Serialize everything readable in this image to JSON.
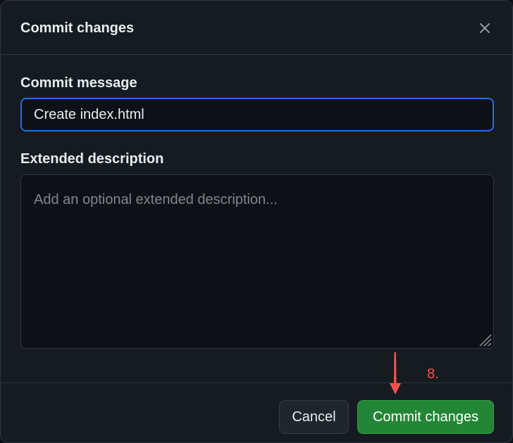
{
  "dialog": {
    "title": "Commit changes",
    "close_label": "Close"
  },
  "form": {
    "message_label": "Commit message",
    "message_value": "Create index.html",
    "description_label": "Extended description",
    "description_placeholder": "Add an optional extended description..."
  },
  "footer": {
    "cancel_label": "Cancel",
    "commit_label": "Commit changes"
  },
  "annotation": {
    "step": "8.",
    "color": "#f85149"
  },
  "icons": {
    "close": "close-icon",
    "resize": "resize-grip-icon",
    "arrow": "down-arrow-icon"
  },
  "colors": {
    "background": "#161b22",
    "focus_border": "#1f6feb",
    "commit_button": "#238636"
  }
}
